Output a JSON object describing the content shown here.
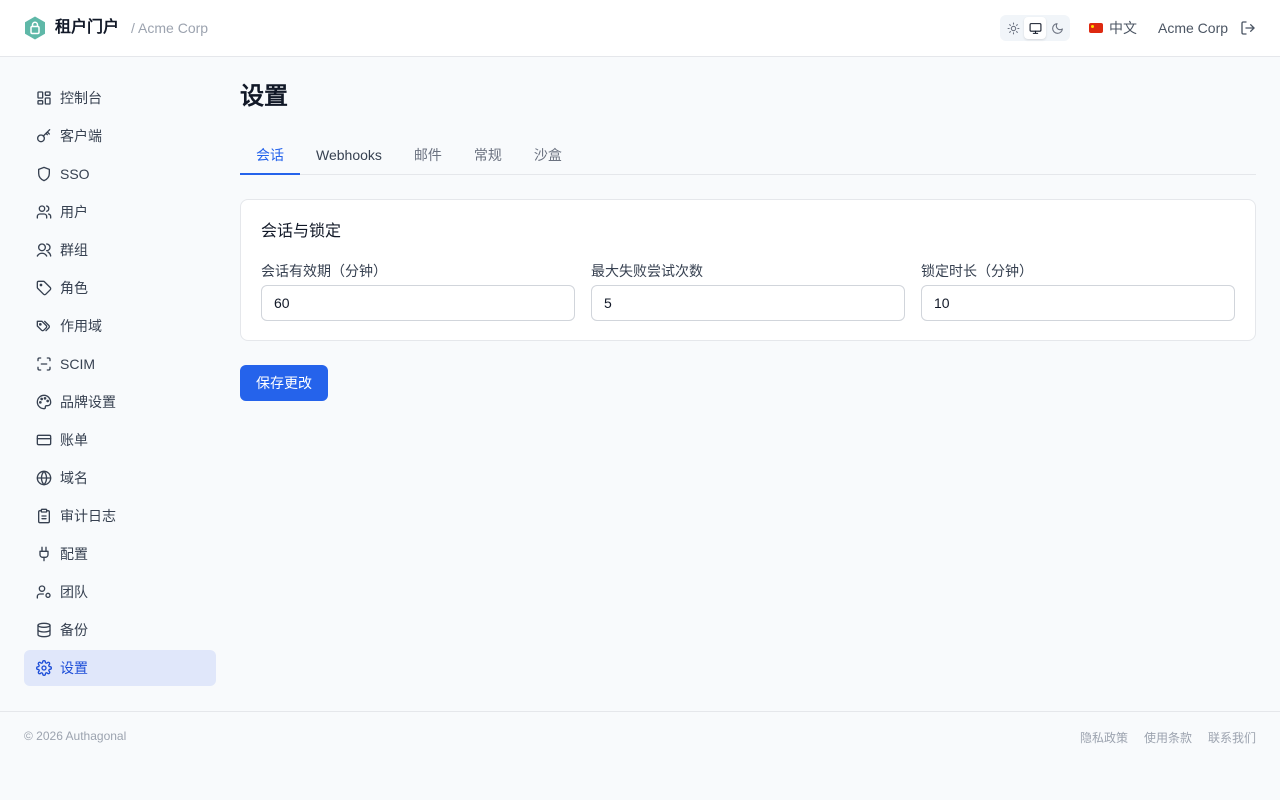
{
  "header": {
    "title": "租户门户",
    "breadcrumb_sep": "/",
    "breadcrumb_tenant": "Acme Corp",
    "language": "中文",
    "tenant_name": "Acme Corp",
    "theme_modes": [
      "light",
      "system",
      "dark"
    ],
    "active_theme": "system"
  },
  "sidebar": {
    "items": [
      {
        "label": "控制台",
        "icon": "dashboard-icon"
      },
      {
        "label": "客户端",
        "icon": "key-icon"
      },
      {
        "label": "SSO",
        "icon": "shield-icon"
      },
      {
        "label": "用户",
        "icon": "users-icon"
      },
      {
        "label": "群组",
        "icon": "group-icon"
      },
      {
        "label": "角色",
        "icon": "tag-icon"
      },
      {
        "label": "作用域",
        "icon": "tags-icon"
      },
      {
        "label": "SCIM",
        "icon": "scan-icon"
      },
      {
        "label": "品牌设置",
        "icon": "palette-icon"
      },
      {
        "label": "账单",
        "icon": "credit-card-icon"
      },
      {
        "label": "域名",
        "icon": "globe-icon"
      },
      {
        "label": "审计日志",
        "icon": "clipboard-icon"
      },
      {
        "label": "配置",
        "icon": "plug-icon"
      },
      {
        "label": "团队",
        "icon": "user-cog-icon"
      },
      {
        "label": "备份",
        "icon": "database-icon"
      },
      {
        "label": "设置",
        "icon": "gear-icon"
      }
    ],
    "active": "设置"
  },
  "main": {
    "title": "设置",
    "tabs": [
      "会话",
      "Webhooks",
      "邮件",
      "常规",
      "沙盒"
    ],
    "active_tab": "会话",
    "card": {
      "title": "会话与锁定",
      "fields": [
        {
          "label": "会话有效期（分钟）",
          "value": "60"
        },
        {
          "label": "最大失败尝试次数",
          "value": "5"
        },
        {
          "label": "锁定时长（分钟）",
          "value": "10"
        }
      ]
    },
    "save_label": "保存更改"
  },
  "footer": {
    "copyright": "© 2026 Authagonal",
    "links": [
      "隐私政策",
      "使用条款",
      "联系我们"
    ]
  },
  "colors": {
    "accent": "#2563eb",
    "brand": "#5fb8a8",
    "active_nav_bg": "#e0e7fa"
  }
}
